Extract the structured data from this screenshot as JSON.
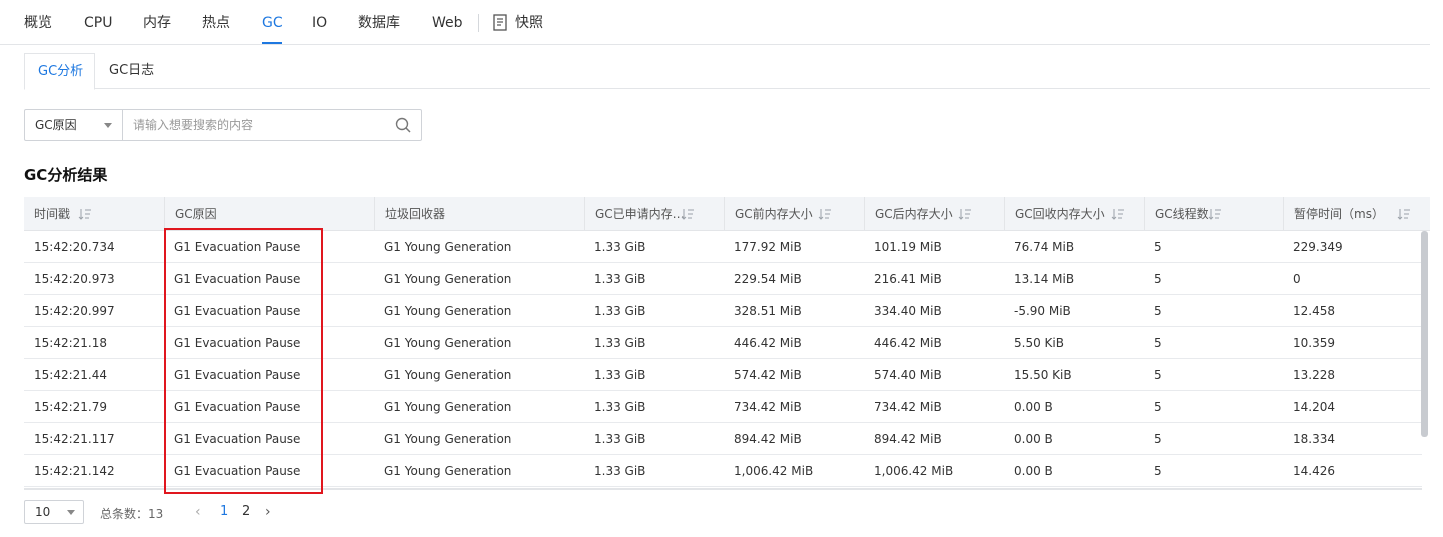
{
  "nav": {
    "tabs": [
      "概览",
      "CPU",
      "内存",
      "热点",
      "GC",
      "IO",
      "数据库",
      "Web"
    ],
    "active": "GC",
    "snapshot_label": "快照",
    "snapshot_icon": "document-snapshot-icon"
  },
  "subtabs": {
    "items": [
      "GC分析",
      "GC日志"
    ],
    "active": "GC分析"
  },
  "search": {
    "field_select": "GC原因",
    "placeholder": "请输入想要搜索的内容",
    "value": "",
    "icon": "search-icon"
  },
  "section_title": "GC分析结果",
  "table": {
    "columns": [
      "时间戳",
      "GC原因",
      "垃圾回收器",
      "GC已申请内存…",
      "GC前内存大小",
      "GC后内存大小",
      "GC回收内存大小",
      "GC线程数",
      "暂停时间（ms）"
    ],
    "sortable": [
      true,
      false,
      false,
      true,
      true,
      true,
      true,
      true,
      true
    ],
    "rows": [
      [
        "15:42:20.734",
        "G1 Evacuation Pause",
        "G1 Young Generation",
        "1.33 GiB",
        "177.92 MiB",
        "101.19 MiB",
        "76.74 MiB",
        "5",
        "229.349"
      ],
      [
        "15:42:20.973",
        "G1 Evacuation Pause",
        "G1 Young Generation",
        "1.33 GiB",
        "229.54 MiB",
        "216.41 MiB",
        "13.14 MiB",
        "5",
        "0"
      ],
      [
        "15:42:20.997",
        "G1 Evacuation Pause",
        "G1 Young Generation",
        "1.33 GiB",
        "328.51 MiB",
        "334.40 MiB",
        "-5.90 MiB",
        "5",
        "12.458"
      ],
      [
        "15:42:21.18",
        "G1 Evacuation Pause",
        "G1 Young Generation",
        "1.33 GiB",
        "446.42 MiB",
        "446.42 MiB",
        "5.50 KiB",
        "5",
        "10.359"
      ],
      [
        "15:42:21.44",
        "G1 Evacuation Pause",
        "G1 Young Generation",
        "1.33 GiB",
        "574.42 MiB",
        "574.40 MiB",
        "15.50 KiB",
        "5",
        "13.228"
      ],
      [
        "15:42:21.79",
        "G1 Evacuation Pause",
        "G1 Young Generation",
        "1.33 GiB",
        "734.42 MiB",
        "734.42 MiB",
        "0.00 B",
        "5",
        "14.204"
      ],
      [
        "15:42:21.117",
        "G1 Evacuation Pause",
        "G1 Young Generation",
        "1.33 GiB",
        "894.42 MiB",
        "894.42 MiB",
        "0.00 B",
        "5",
        "18.334"
      ],
      [
        "15:42:21.142",
        "G1 Evacuation Pause",
        "G1 Young Generation",
        "1.33 GiB",
        "1,006.42 MiB",
        "1,006.42 MiB",
        "0.00 B",
        "5",
        "14.426"
      ]
    ]
  },
  "pagination": {
    "page_size": "10",
    "total_label": "总条数：13",
    "pages": [
      "1",
      "2"
    ],
    "current": "1"
  },
  "colors": {
    "accent": "#1e78e0",
    "highlight": "#e0161e",
    "header_bg": "#f2f4f7"
  }
}
